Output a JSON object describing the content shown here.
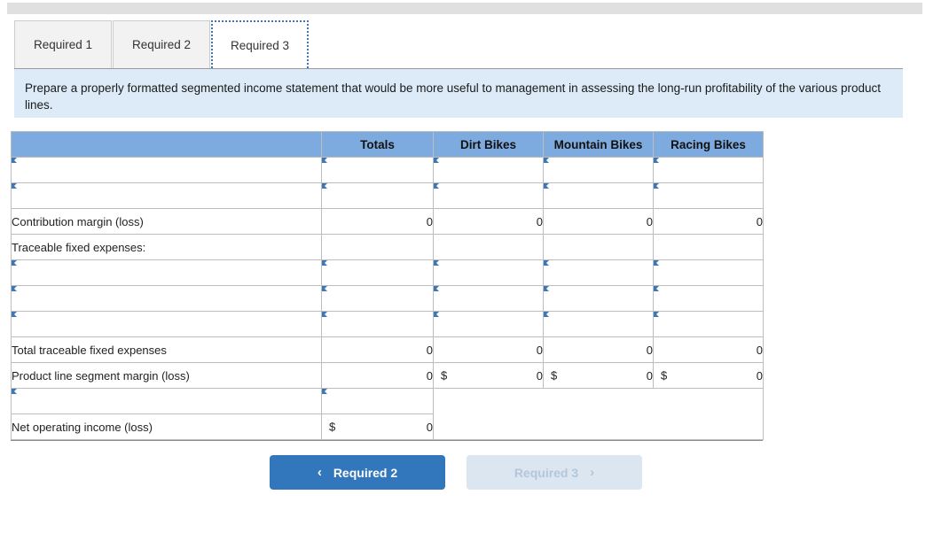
{
  "tabs": [
    {
      "label": "Required 1",
      "active": false
    },
    {
      "label": "Required 2",
      "active": false
    },
    {
      "label": "Required 3",
      "active": true
    }
  ],
  "instruction": "Prepare a properly formatted segmented income statement that would be more useful to management in assessing the long-run profitability of the various product lines.",
  "table": {
    "headers": [
      "",
      "Totals",
      "Dirt Bikes",
      "Mountain Bikes",
      "Racing Bikes"
    ],
    "rows": [
      {
        "type": "edit",
        "label": "",
        "totals": "",
        "dirt": "",
        "mountain": "",
        "racing": ""
      },
      {
        "type": "edit",
        "label": "",
        "totals": "",
        "dirt": "",
        "mountain": "",
        "racing": ""
      },
      {
        "type": "total",
        "label": "Contribution margin (loss)",
        "totals": "0",
        "dirt": "0",
        "mountain": "0",
        "racing": "0"
      },
      {
        "type": "plain",
        "label": "Traceable fixed expenses:",
        "totals": "",
        "dirt": "",
        "mountain": "",
        "racing": ""
      },
      {
        "type": "edit",
        "label": "",
        "totals": "",
        "dirt": "",
        "mountain": "",
        "racing": ""
      },
      {
        "type": "edit",
        "label": "",
        "totals": "",
        "dirt": "",
        "mountain": "",
        "racing": ""
      },
      {
        "type": "edit",
        "label": "",
        "totals": "",
        "dirt": "",
        "mountain": "",
        "racing": ""
      },
      {
        "type": "total",
        "label": "Total traceable fixed expenses",
        "totals": "0",
        "dirt": "0",
        "mountain": "0",
        "racing": "0"
      },
      {
        "type": "money",
        "label": "Product line segment margin (loss)",
        "currency": "$",
        "totals": "0",
        "dirt": "0",
        "mountain": "0",
        "racing": "0"
      },
      {
        "type": "edit-short",
        "label": "",
        "totals": ""
      },
      {
        "type": "money-short",
        "label": "Net operating income (loss)",
        "currency": "$",
        "totals": "0"
      }
    ]
  },
  "nav": {
    "prev_label": "Required 2",
    "prev_icon": "chevron-left-icon",
    "prev_chevron": "‹",
    "next_label": "Required 3",
    "next_icon": "chevron-right-icon",
    "next_chevron": "›"
  },
  "colors": {
    "header_blue": "#7eabdf",
    "banner_blue": "#dcebf7",
    "button_blue": "#3277bc",
    "button_disabled": "#dce6f1",
    "edit_border": "#5b90cb",
    "edit_marker": "#3f77b5"
  }
}
